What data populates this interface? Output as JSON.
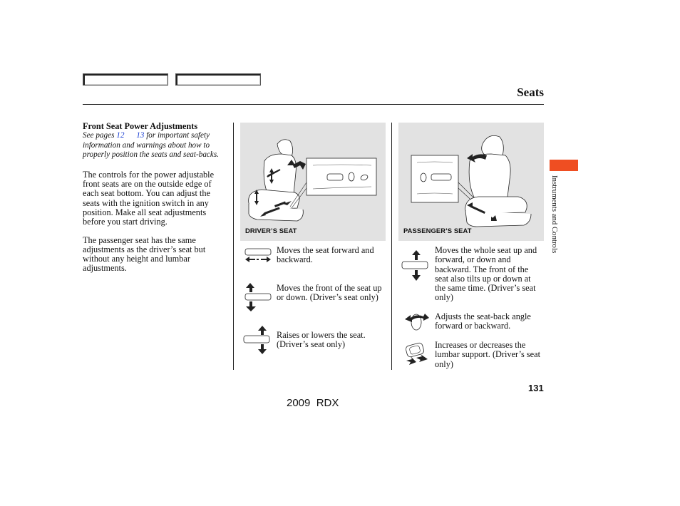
{
  "nav": {
    "buttons": [
      "",
      ""
    ]
  },
  "header": {
    "title": "Seats"
  },
  "left": {
    "heading": "Front Seat Power Adjustments",
    "note_prefix": "See pages ",
    "note_link1": "12",
    "note_link2": "13",
    "note_suffix": " for important safety information and warnings about how to properly position the seats and seat-backs.",
    "para1": "The controls for the power adjustable front seats are on the outside edge of each seat bottom. You can adjust the seats with the ignition switch in any position. Make all seat adjustments before you start driving.",
    "para2": "The passenger seat has the same adjustments as the driver’s seat but without any height and lumbar adjustments."
  },
  "figures": {
    "driver_label": "DRIVER’S SEAT",
    "passenger_label": "PASSENGER’S SEAT"
  },
  "controls": [
    {
      "icon": "slide-switch-fore-aft-icon",
      "text": "Moves the seat forward and backward."
    },
    {
      "icon": "switch-front-up-down-icon",
      "text": "Moves the front of the seat up or down. (Driver’s seat only)"
    },
    {
      "icon": "switch-rear-up-down-icon",
      "text": "Raises or lowers the seat. (Driver’s seat only)"
    },
    {
      "icon": "switch-whole-seat-up-down-icon",
      "text": "Moves the whole seat up and forward, or down and backward. The front of the seat also tilts up or down at the same time. (Driver’s seat only)"
    },
    {
      "icon": "seatback-recline-switch-icon",
      "text": "Adjusts the seat-back angle forward or backward."
    },
    {
      "icon": "lumbar-switch-icon",
      "text": "Increases or decreases the lumbar support. (Driver’s seat only)"
    }
  ],
  "sidebar": {
    "section": "Instruments and Controls",
    "accent": "#ef4e22"
  },
  "footer": {
    "page_number": "131",
    "model": "2009  RDX"
  }
}
